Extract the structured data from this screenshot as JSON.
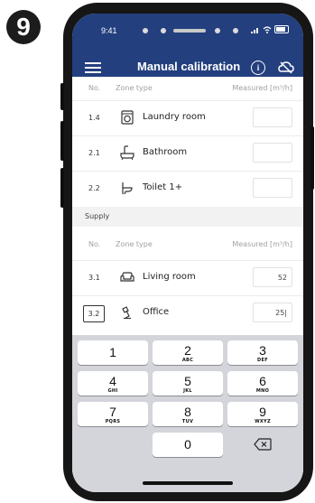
{
  "step_badge": "9",
  "status": {
    "time": "9:41"
  },
  "header": {
    "title": "Manual calibration",
    "icons": [
      "menu-icon",
      "info-icon",
      "sync-off-icon"
    ]
  },
  "table": {
    "columns": {
      "no": "No.",
      "zone": "Zone type",
      "measured": "Measured [m³/h]"
    }
  },
  "exhaust_rows": [
    {
      "no": "1.4",
      "name": "Laundry room",
      "icon": "washing-machine-icon",
      "value": ""
    },
    {
      "no": "2.1",
      "name": "Bathroom",
      "icon": "bathtub-icon",
      "value": ""
    },
    {
      "no": "2.2",
      "name": "Toilet 1+",
      "icon": "toilet-icon",
      "value": ""
    }
  ],
  "supply": {
    "title": "Supply",
    "columns": {
      "no": "No.",
      "zone": "Zone type",
      "measured": "Measured [m³/h]"
    },
    "rows": [
      {
        "no": "3.1",
        "name": "Living room",
        "icon": "sofa-icon",
        "value": "52"
      },
      {
        "no": "3.2",
        "name": "Office",
        "icon": "desk-lamp-icon",
        "value": "25|"
      }
    ]
  },
  "keypad": {
    "keys": [
      {
        "digit": "1",
        "letters": ""
      },
      {
        "digit": "2",
        "letters": "ABC"
      },
      {
        "digit": "3",
        "letters": "DEF"
      },
      {
        "digit": "4",
        "letters": "GHI"
      },
      {
        "digit": "5",
        "letters": "JKL"
      },
      {
        "digit": "6",
        "letters": "MNO"
      },
      {
        "digit": "7",
        "letters": "PQRS"
      },
      {
        "digit": "8",
        "letters": "TUV"
      },
      {
        "digit": "9",
        "letters": "WXYZ"
      },
      {
        "digit": "0",
        "letters": ""
      }
    ],
    "delete_icon": "backspace-icon"
  }
}
